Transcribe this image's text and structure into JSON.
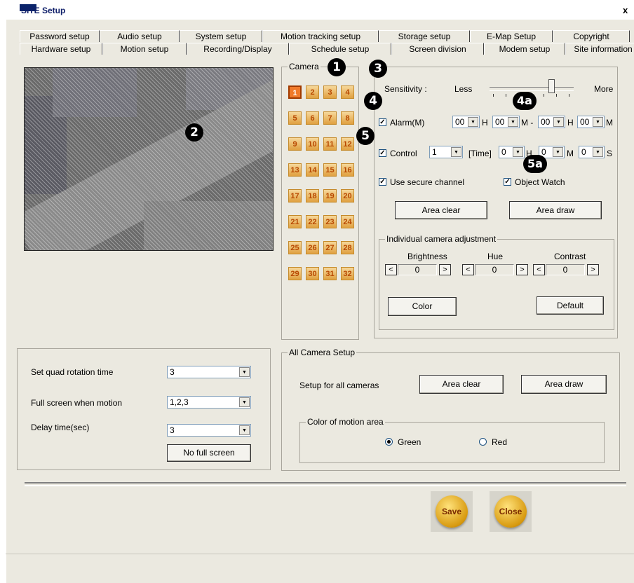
{
  "window": {
    "title": "SITE Setup",
    "close": "x"
  },
  "tabs_top": [
    "Password setup",
    "Audio setup",
    "System setup",
    "Motion tracking setup",
    "Storage setup",
    "E-Map Setup",
    "Copyright"
  ],
  "tabs_bottom": [
    "Hardware setup",
    "Motion setup",
    "Recording/Display",
    "Schedule setup",
    "Screen division",
    "Modem setup",
    "Site information"
  ],
  "active_tab": "Motion setup",
  "markers": {
    "m1": "1",
    "m2": "2",
    "m3": "3",
    "m4": "4",
    "m4a": "4a",
    "m5": "5",
    "m5a": "5a"
  },
  "camera": {
    "legend": "Camera",
    "buttons": [
      "1",
      "2",
      "3",
      "4",
      "5",
      "6",
      "7",
      "8",
      "9",
      "10",
      "11",
      "12",
      "13",
      "14",
      "15",
      "16",
      "17",
      "18",
      "19",
      "20",
      "21",
      "22",
      "23",
      "24",
      "25",
      "26",
      "27",
      "28",
      "29",
      "30",
      "31",
      "32"
    ],
    "selected": "1"
  },
  "motion": {
    "sensitivity_label": "Sensitivity :",
    "less": "Less",
    "more": "More",
    "sensitivity_level": 0.8,
    "alarm": {
      "label": "Alarm(M)",
      "checked": true,
      "h1": "00",
      "h_label": "H",
      "m1": "00",
      "m_dash": "M -",
      "h2": "00",
      "h_label2": "H",
      "m2": "00",
      "m_label2": "M"
    },
    "control": {
      "label": "Control",
      "checked": true,
      "value": "1",
      "time_label": "[Time]",
      "h": "0",
      "h_label": "H",
      "m": "0",
      "m_label": "M",
      "s": "0",
      "s_label": "S"
    },
    "secure": {
      "label": "Use secure channel",
      "checked": true
    },
    "object_watch": {
      "label": "Object Watch",
      "checked": true
    },
    "area_clear": "Area clear",
    "area_draw": "Area draw"
  },
  "adjust": {
    "legend": "Individual camera adjustment",
    "brightness": "Brightness",
    "hue": "Hue",
    "contrast": "Contrast",
    "brightness_val": "0",
    "hue_val": "0",
    "contrast_val": "0",
    "dec": "<",
    "inc": ">",
    "color": "Color",
    "default": "Default"
  },
  "quad": {
    "rotation_label": "Set quad rotation time",
    "rotation_val": "3",
    "fullscreen_label": "Full screen when motion",
    "fullscreen_val": "1,2,3",
    "delay_label": "Delay time(sec)",
    "delay_val": "3",
    "no_full": "No full screen"
  },
  "all": {
    "legend": "All Camera Setup",
    "setup_label": "Setup for all cameras",
    "area_clear": "Area clear",
    "area_draw": "Area draw",
    "color_legend": "Color of motion area",
    "green": "Green",
    "red": "Red",
    "selected": "Green"
  },
  "footer": {
    "save": "Save",
    "close": "Close"
  },
  "colors": {
    "accent": "#0a246a",
    "camera_btn": "#e0a040",
    "camera_selected": "#f07a2a",
    "round_btn": "#d89a10"
  }
}
